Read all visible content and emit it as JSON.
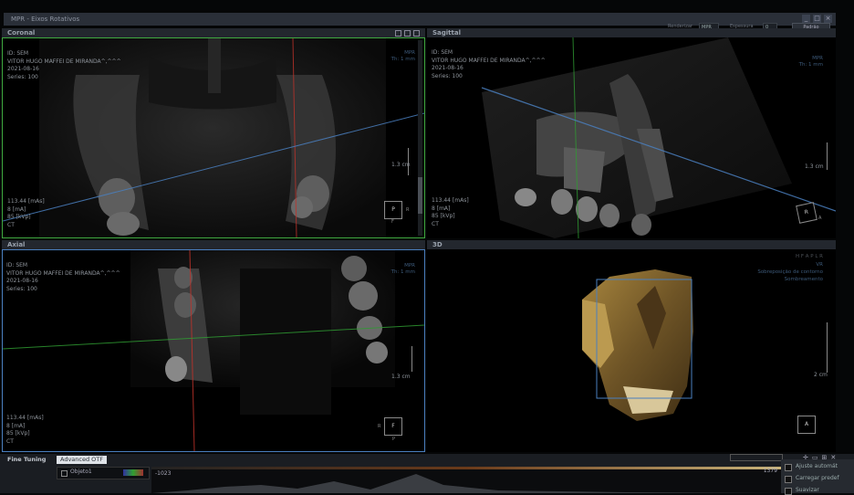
{
  "window": {
    "title": "MPR - Eixos Rotativos",
    "controls": [
      "_",
      "□",
      "×"
    ]
  },
  "toolbar": {
    "rendering_label": "Renderizar",
    "rendering_value": "MPR",
    "thickness_label": "Espessura",
    "thickness_value": "0",
    "default_button": "Padrão"
  },
  "panels": {
    "coronal": {
      "title": "Coronal",
      "id": "ID: SEM",
      "patient": "VITOR HUGO MAFFEI DE MIRANDA^,^^^",
      "date": "2021-08-16",
      "series": "Series: 100",
      "mode": "MPR",
      "thickness": "Th: 1 mm",
      "mas": "113.44 [mAs]",
      "ma": "8 [mA]",
      "kvp": "85 [kVp]",
      "modality": "CT",
      "scale": "1.3 cm",
      "cube_face": "P",
      "cube_side": "R",
      "cube_bottom": "F"
    },
    "sagittal": {
      "title": "Sagittal",
      "id": "ID: SEM",
      "patient": "VITOR HUGO MAFFEI DE MIRANDA^,^^^",
      "date": "2021-08-16",
      "series": "Series: 100",
      "mode": "MPR",
      "thickness": "Th: 1 mm",
      "mas": "113.44 [mAs]",
      "ma": "8 [mA]",
      "kvp": "85 [kVp]",
      "modality": "CT",
      "scale": "1.3 cm",
      "cube_face": "R",
      "cube_side": "A"
    },
    "axial": {
      "title": "Axial",
      "id": "ID: SEM",
      "patient": "VITOR HUGO MAFFEI DE MIRANDA^,^^^",
      "date": "2021-08-16",
      "series": "Series: 100",
      "mode": "MPR",
      "thickness": "Th: 1 mm",
      "mas": "113.44 [mAs]",
      "ma": "8 [mA]",
      "kvp": "85 [kVp]",
      "modality": "CT",
      "scale": "1.3 cm",
      "cube_face": "F",
      "cube_side": "R",
      "cube_bottom": "P"
    },
    "view3d": {
      "title": "3D",
      "orientation": "H F A P L R",
      "preset": "VR",
      "overlay_line1": "Sobreposição de contorno",
      "overlay_line2": "Sombreamento",
      "scale": "2 cm",
      "cube_face": "A"
    }
  },
  "bottom": {
    "tab_fine_tuning": "Fine Tuning",
    "tab_advanced": "Advanced OTF",
    "object_label": "Objeto1",
    "hist_min": "-1023",
    "hist_max": "1379",
    "option1": "Ajuste automát",
    "option2": "Carregar predef",
    "option3": "Suavizar"
  },
  "colors": {
    "coronal_border": "#3fa83f",
    "axial_border": "#4a7fbf",
    "crosshair_red": "#c0322a",
    "crosshair_green": "#2f9a32",
    "crosshair_blue": "#4a7fbf",
    "bone": "#b8974a"
  }
}
